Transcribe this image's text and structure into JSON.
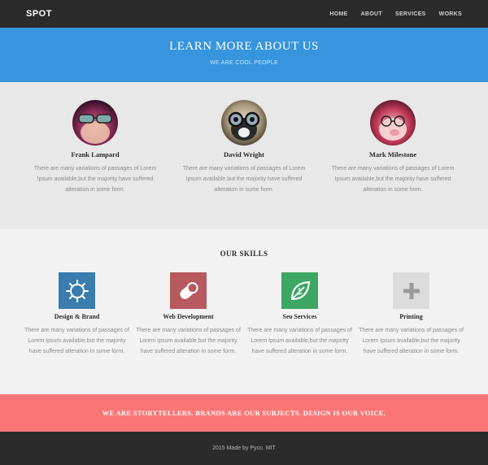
{
  "navbar": {
    "brand": "SPOT",
    "links": [
      "HOME",
      "ABOUT",
      "SERVICES",
      "WORKS"
    ]
  },
  "hero": {
    "title": "LEARN MORE ABOUT US",
    "subtitle": "WE ARE COOL PEOPLE"
  },
  "team": [
    {
      "name": "Frank Lampard",
      "desc": "There are many variations of passages of Lorem Ipsum available,but the majority have suffered alteration in some form.",
      "avatar": "cat-with-sunglasses-avatar"
    },
    {
      "name": "David Wright",
      "desc": "There are many variations of passages of Lorem Ipsum available,but the majority have suffered alteration in some form.",
      "avatar": "dog-with-goggles-avatar"
    },
    {
      "name": "Mark Milestone",
      "desc": "There are many variations of passages of Lorem Ipsum available,but the majority have suffered alteration in some form.",
      "avatar": "pig-with-glasses-avatar"
    }
  ],
  "skills": {
    "title": "OUR SKILLS",
    "items": [
      {
        "name": "Design & Brand",
        "desc": "There are many variations of passages of Lorem Ipsum available,but the majority have suffered alteration in some form.",
        "icon": "sun-gear-icon",
        "color": "#3a7cad"
      },
      {
        "name": "Web Development",
        "desc": "There are many variations of passages of Lorem Ipsum available,but the majority have suffered alteration in some form.",
        "icon": "pill-icon",
        "color": "#b7595f"
      },
      {
        "name": "Seo Services",
        "desc": "There are many variations of passages of Lorem Ipsum available,but the majority have suffered alteration in some form.",
        "icon": "leaf-icon",
        "color": "#3ea664"
      },
      {
        "name": "Printing",
        "desc": "There are many variations of passages of Lorem Ipsum available,but the majority have suffered alteration in some form.",
        "icon": "plus-icon",
        "color": "#dcdcdc"
      }
    ]
  },
  "banner": {
    "text": "WE ARE STORYTELLERS. BRANDS ARE OUR SUBJECTS. DESIGN IS OUR VOICE."
  },
  "footer": {
    "text": "2015 Made by Pyco. MIT"
  },
  "colors": {
    "navbar": "#2b2b2b",
    "hero": "#3695dc",
    "team_bg": "#e8e8e8",
    "skills_bg": "#f2f2f2",
    "banner": "#fa7676",
    "footer": "#2b2b2b"
  }
}
